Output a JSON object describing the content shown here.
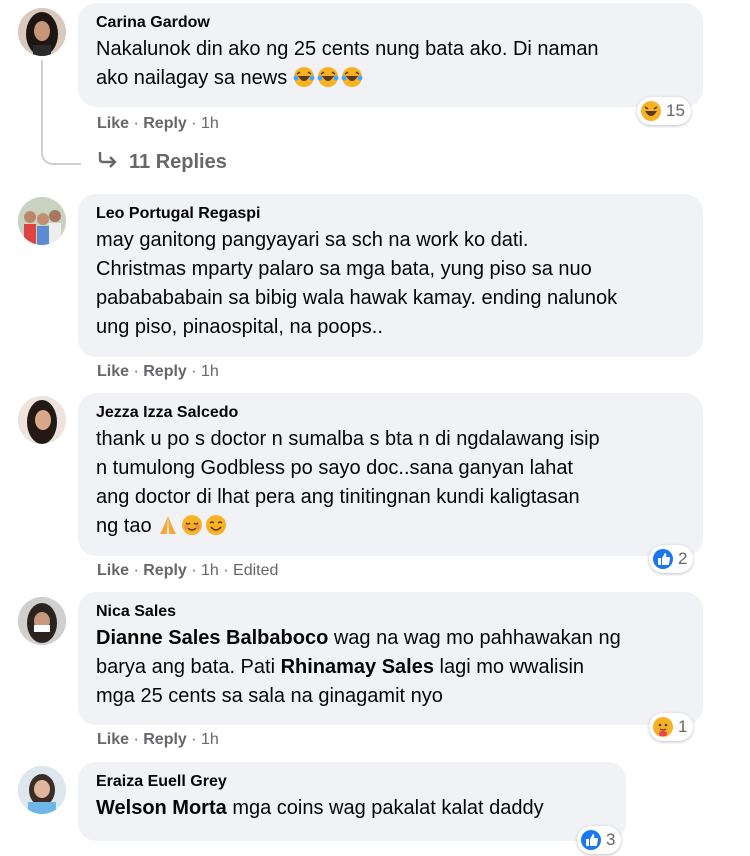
{
  "comments": [
    {
      "author": "Carina Gardow",
      "lines": [
        "Nakalunok din ako ng 25 cents nung bata ako. Di naman",
        "ako nailagay sa news"
      ],
      "emoji": [
        "😂",
        "😂",
        "😂"
      ],
      "actions": {
        "like": "Like",
        "reply": "Reply",
        "time": "1h"
      },
      "reaction": {
        "icon": "haha-icon",
        "count": "15"
      },
      "replies_label": "11 Replies"
    },
    {
      "author": "Leo Portugal Regaspi",
      "lines": [
        "may ganitong pangyayari sa sch na work ko dati.",
        "Christmas mparty palaro sa mga bata, yung piso sa nuo",
        "pababababain sa bibig wala hawak kamay. ending nalunok",
        "ung piso, pinaospital, na poops.."
      ],
      "actions": {
        "like": "Like",
        "reply": "Reply",
        "time": "1h"
      }
    },
    {
      "author": "Jezza Izza Salcedo",
      "lines": [
        "thank u po s doctor n sumalba s bta n di ngdalawang isip",
        "n tumulong Godbless po sayo doc..sana ganyan lahat",
        "ang doctor di lhat pera ang tinitingnan kundi kaligtasan",
        "ng tao"
      ],
      "emoji": [
        "🙏",
        "😌",
        "😊"
      ],
      "actions": {
        "like": "Like",
        "reply": "Reply",
        "time": "1h",
        "edited": "Edited"
      },
      "reaction": {
        "icon": "like-icon",
        "count": "2"
      }
    },
    {
      "author": "Nica Sales",
      "mention1": "Dianne Sales Balbaboco",
      "text1": " wag na wag mo pahhawakan ng",
      "line2_start": "barya ang bata. Pati ",
      "mention2": "Rhinamay Sales",
      "text2": " lagi mo wwalisin",
      "line3": "mga 25 cents sa sala na ginagamit nyo",
      "actions": {
        "like": "Like",
        "reply": "Reply",
        "time": "1h"
      },
      "reaction": {
        "icon": "care-icon",
        "count": "1"
      }
    },
    {
      "author": "Eraiza Euell Grey",
      "mention": "Welson Morta",
      "text": " mga coins wag pakalat kalat daddy",
      "reaction": {
        "icon": "like-icon",
        "count": "3"
      }
    }
  ],
  "colors": {
    "bubble": "#f0f2f5",
    "meta": "#65676b",
    "like_blue": "#1877f2",
    "haha_yellow": "#f7b125"
  }
}
